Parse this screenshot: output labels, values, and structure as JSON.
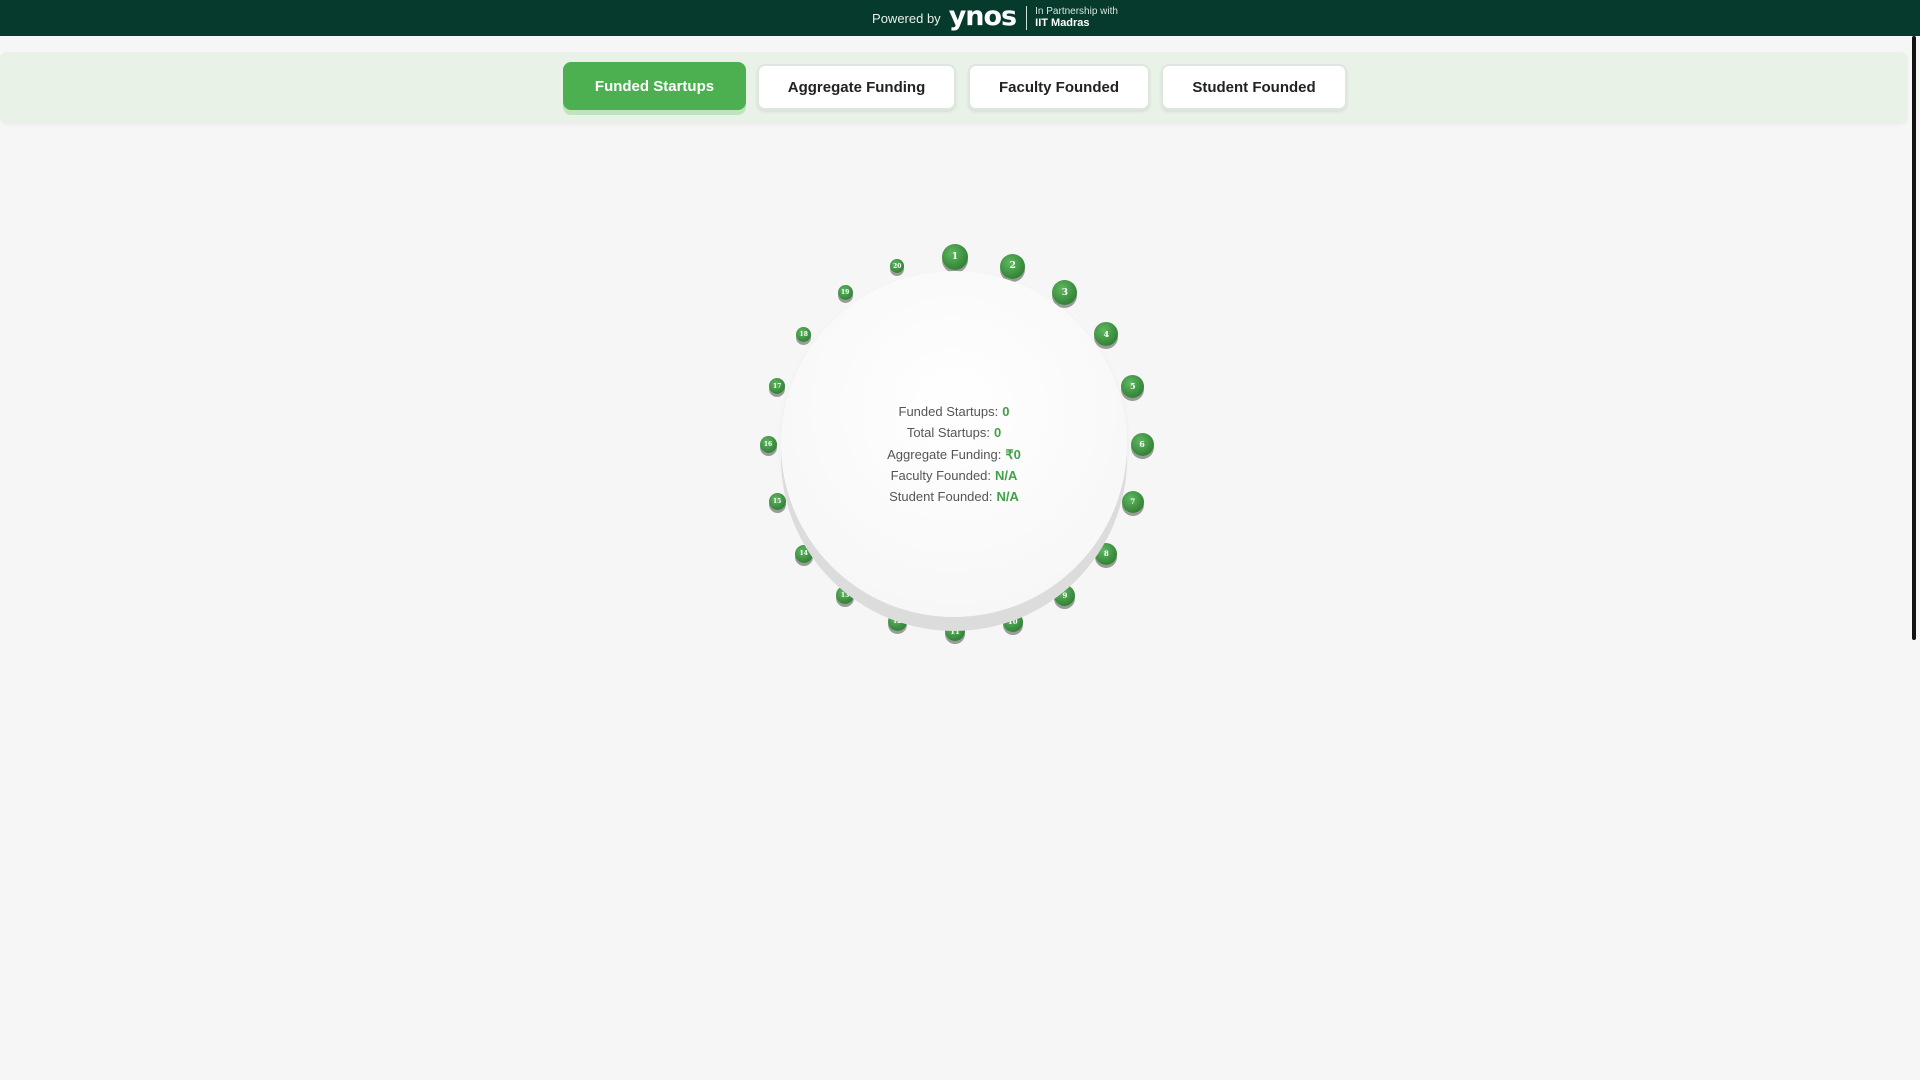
{
  "header": {
    "powered_by": "Powered by",
    "logo_text": "ynos",
    "partner_line1": "In Partnership with",
    "partner_line2": "IIT Madras"
  },
  "tabs": [
    {
      "label": "Funded Startups",
      "active": true
    },
    {
      "label": "Aggregate Funding",
      "active": false
    },
    {
      "label": "Faculty Founded",
      "active": false
    },
    {
      "label": "Student Founded",
      "active": false
    }
  ],
  "nodes": [
    "1",
    "2",
    "3",
    "4",
    "5",
    "6",
    "7",
    "8",
    "9",
    "10",
    "11",
    "12",
    "13",
    "14",
    "15",
    "16",
    "17",
    "18",
    "19",
    "20"
  ],
  "stats": [
    {
      "label": "Funded Startups:",
      "value": "0"
    },
    {
      "label": "Total Startups:",
      "value": "0"
    },
    {
      "label": "Aggregate Funding:",
      "value": "₹0"
    },
    {
      "label": "Faculty Founded:",
      "value": "N/A"
    },
    {
      "label": "Student Founded:",
      "value": "N/A"
    }
  ],
  "colors": {
    "header_bg": "#063a2c",
    "accent": "#4caf50",
    "tabbar_bg": "#e8f2e6"
  }
}
